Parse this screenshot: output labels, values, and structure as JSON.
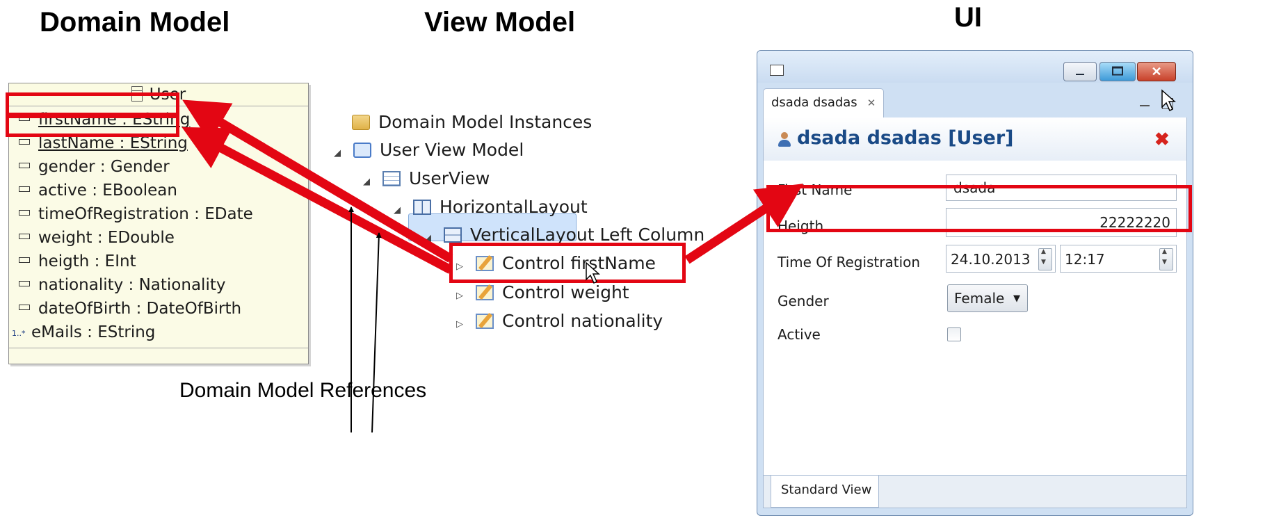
{
  "headings": {
    "domain_model": "Domain Model",
    "view_model": "View Model",
    "ui": "UI"
  },
  "uml_class": {
    "name": "User",
    "attributes": [
      {
        "label": "firstName : EString",
        "icon": "attribute-icon"
      },
      {
        "label": "lastName : EString",
        "icon": "id-attribute-icon"
      },
      {
        "label": "gender : Gender",
        "icon": "attribute-icon"
      },
      {
        "label": "active : EBoolean",
        "icon": "attribute-icon"
      },
      {
        "label": "timeOfRegistration : EDate",
        "icon": "attribute-icon"
      },
      {
        "label": "weight : EDouble",
        "icon": "attribute-icon"
      },
      {
        "label": "heigth : EInt",
        "icon": "attribute-icon"
      },
      {
        "label": "nationality : Nationality",
        "icon": "attribute-icon"
      },
      {
        "label": "dateOfBirth : DateOfBirth",
        "icon": "attribute-icon"
      },
      {
        "label": "eMails : EString",
        "icon": "multi-attribute-icon",
        "multiplicity": "1..*"
      }
    ]
  },
  "tree": [
    {
      "label": "Domain Model Instances",
      "icon": "folder-icon"
    },
    {
      "label": "User View Model",
      "icon": "view-model-icon"
    },
    {
      "label": "UserView",
      "icon": "view-icon"
    },
    {
      "label": "HorizontalLayout",
      "icon": "horizontal-layout-icon"
    },
    {
      "label": "VerticalLayout Left Column",
      "icon": "vertical-layout-icon"
    },
    {
      "label": "Control firstName",
      "icon": "control-icon",
      "selected": true
    },
    {
      "label": "Control weight",
      "icon": "control-icon"
    },
    {
      "label": "Control nationality",
      "icon": "control-icon"
    }
  ],
  "annotation": "Domain  Model References",
  "window": {
    "tab_label": "dsada dsadas",
    "form_title": "dsada dsadas [User]",
    "fields": {
      "first_name": {
        "label": "First Name",
        "value": "dsada"
      },
      "heigth": {
        "label": "Heigth",
        "value": "22222220"
      },
      "time_of_registration": {
        "label": "Time Of Registration",
        "date": "24.10.2013",
        "time": "12:17"
      },
      "gender": {
        "label": "Gender",
        "value": "Female"
      },
      "active": {
        "label": "Active",
        "checked": false
      }
    },
    "bottom_tab": "Standard View"
  },
  "colors": {
    "highlight": "#e30613",
    "selection": "#cfe3fb",
    "uml_bg": "#fbfbe6",
    "title_blue": "#1a4a86"
  }
}
